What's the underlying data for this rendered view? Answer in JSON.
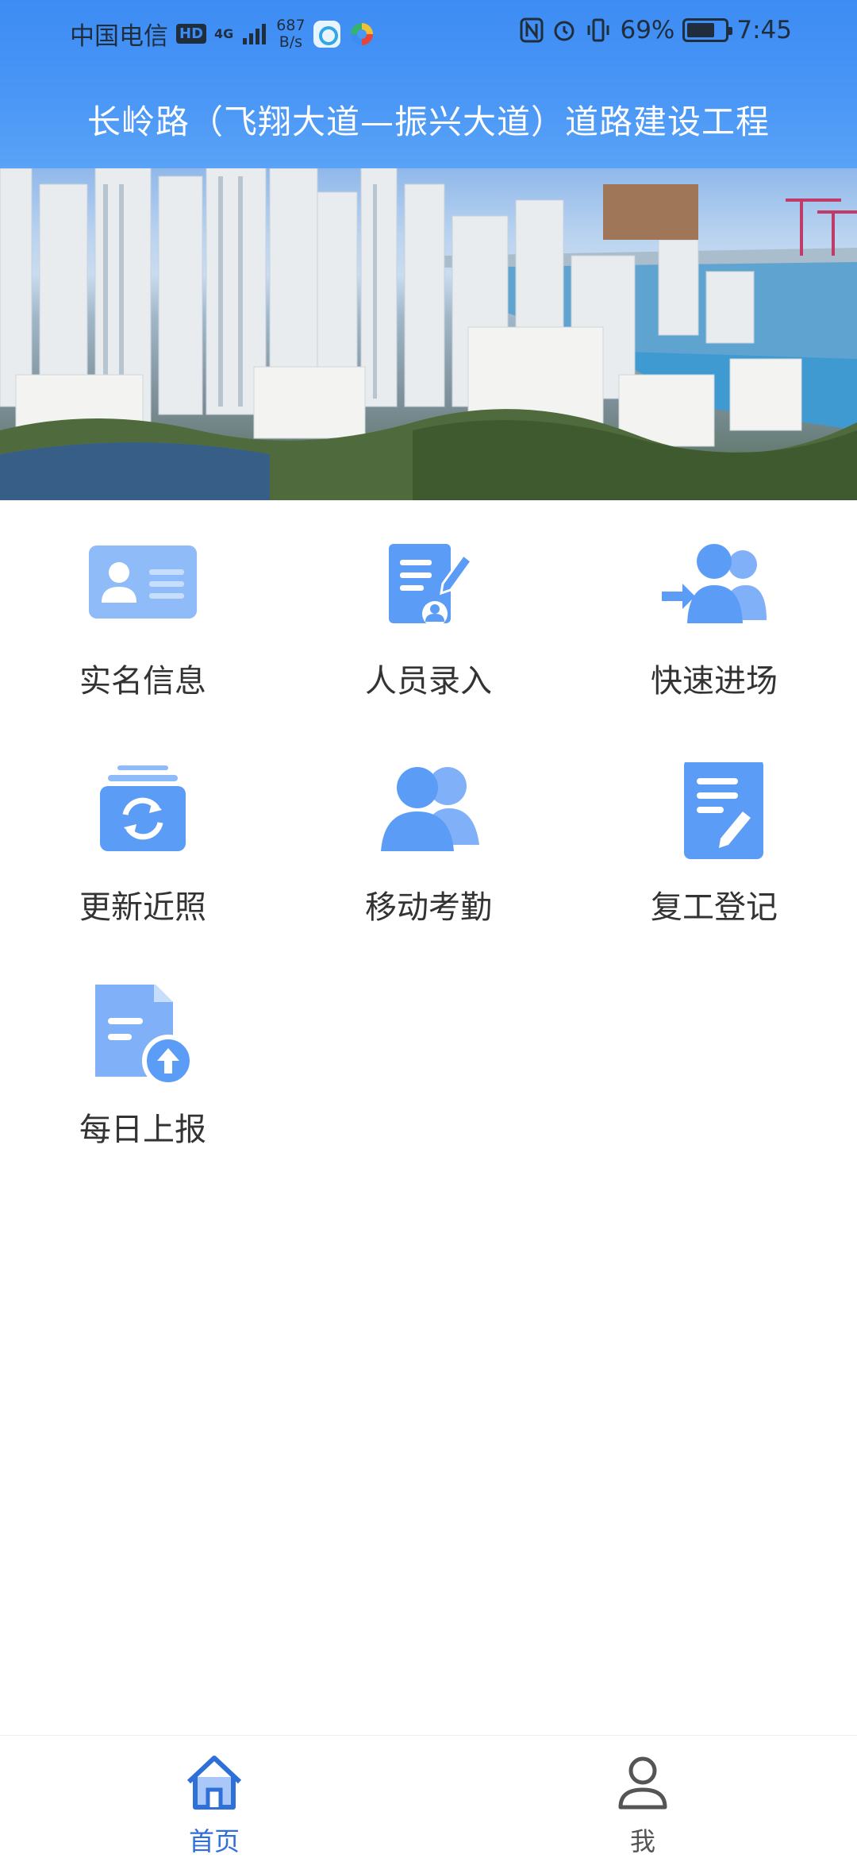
{
  "status_bar": {
    "carrier": "中国电信",
    "hd": "HD",
    "net_type": "4G",
    "speed_value": "687",
    "speed_unit": "B/s",
    "battery": "69%",
    "time": "7:45"
  },
  "header": {
    "title": "长岭路（飞翔大道—振兴大道）道路建设工程"
  },
  "banner": {
    "slide_count": 2,
    "active_slide": 2,
    "dot_inactive_color": "#ffffff",
    "dot_active_color": "#1a2fd6"
  },
  "menu": {
    "items": [
      {
        "label": "实名信息",
        "icon": "id-card-icon"
      },
      {
        "label": "人员录入",
        "icon": "edit-document-icon"
      },
      {
        "label": "快速进场",
        "icon": "group-enter-icon"
      },
      {
        "label": "更新近照",
        "icon": "refresh-photo-icon"
      },
      {
        "label": "移动考勤",
        "icon": "people-icon"
      },
      {
        "label": "复工登记",
        "icon": "register-document-icon"
      },
      {
        "label": "每日上报",
        "icon": "upload-file-icon"
      }
    ]
  },
  "tabbar": {
    "tabs": [
      {
        "label": "首页",
        "icon": "home-icon",
        "active": true
      },
      {
        "label": "我",
        "icon": "user-icon",
        "active": false
      }
    ],
    "active_color": "#2f6fd8",
    "inactive_color": "#555555"
  },
  "colors": {
    "icon_blue": "#5b9cf7",
    "icon_light": "#9ec4fb"
  }
}
